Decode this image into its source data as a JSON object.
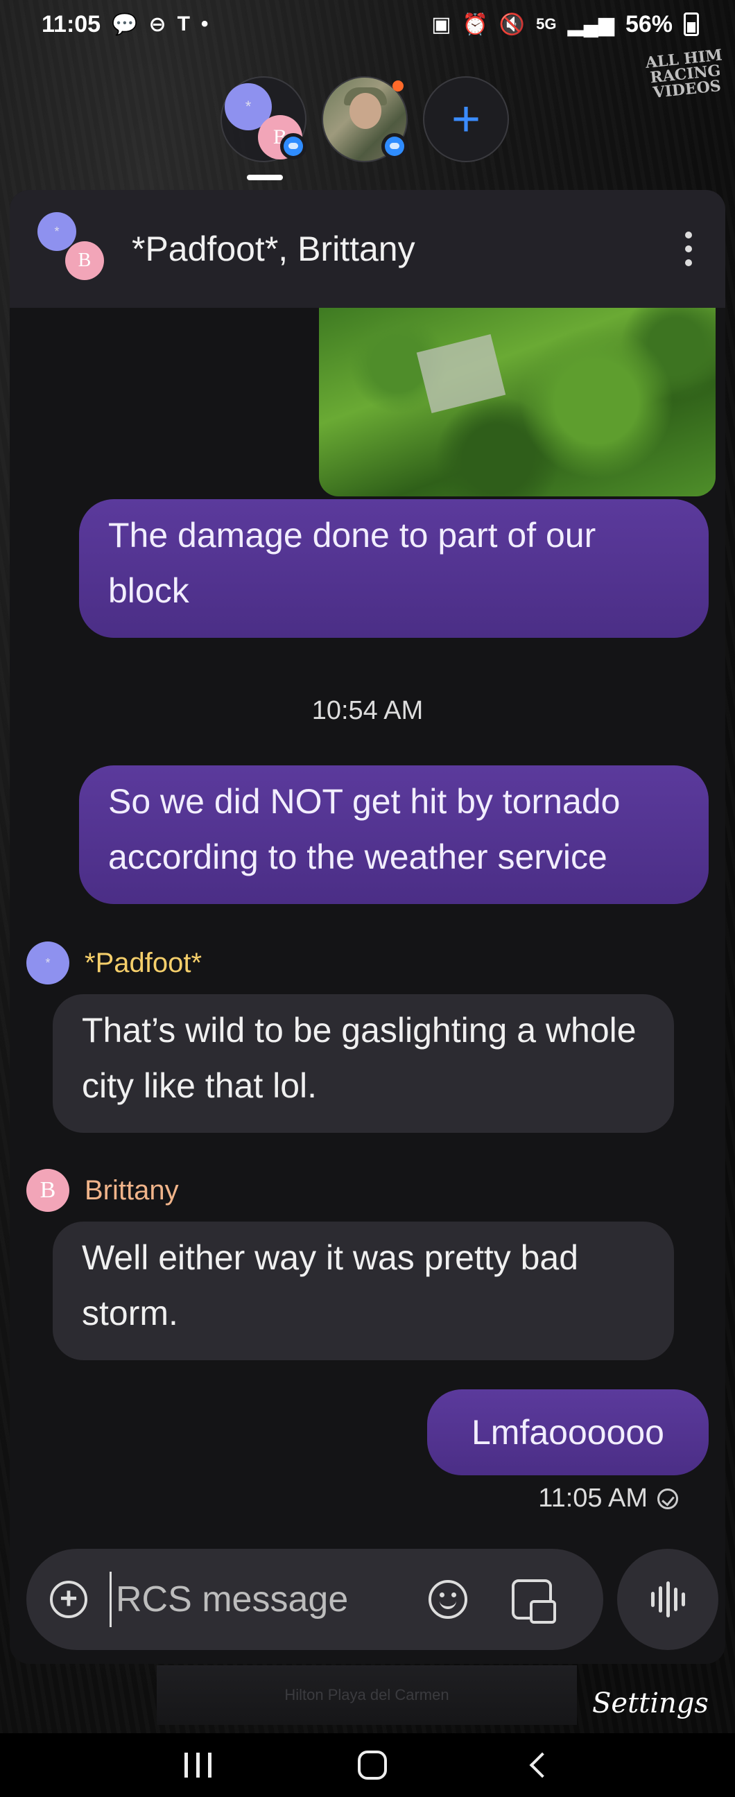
{
  "status_bar": {
    "time": "11:05",
    "carrier_icon": "T",
    "network": "5G",
    "battery_percent": "56%"
  },
  "bubble_heads": [
    {
      "name": "group-conversation",
      "avatar_letters": [
        "*",
        "B"
      ]
    },
    {
      "name": "contact-photo"
    },
    {
      "name": "add-bubble",
      "icon": "+"
    }
  ],
  "watermark": "ALL HIM RACING VIDEOS",
  "conversation": {
    "title": "*Padfoot*, Brittany",
    "avatar_a": "*",
    "avatar_b": "B"
  },
  "messages": [
    {
      "type": "outgoing",
      "text": "The damage done to part of our block"
    },
    {
      "type": "timestamp",
      "text": "10:54 AM"
    },
    {
      "type": "outgoing",
      "text": "So we did NOT get hit by tornado according to the weather service"
    },
    {
      "type": "incoming",
      "sender": "*Padfoot*",
      "avatar": "*",
      "text": "That’s wild to be gaslighting a whole city like that lol."
    },
    {
      "type": "incoming",
      "sender": "Brittany",
      "avatar": "B",
      "text": "Well either way it was pretty bad storm."
    },
    {
      "type": "outgoing",
      "text": "Lmfaoooooo"
    }
  ],
  "sent_time": "11:05 AM",
  "compose": {
    "placeholder": "RCS message"
  },
  "bottom": {
    "map_label": "Hilton Playa del Carmen",
    "settings_label": "Settings"
  },
  "colors": {
    "outgoing_bubble": "#4f3190",
    "incoming_bubble": "#2c2b31",
    "padfoot_name": "#f5cf6b",
    "brittany_name": "#f0b48a",
    "accent": "#2f8cff"
  }
}
